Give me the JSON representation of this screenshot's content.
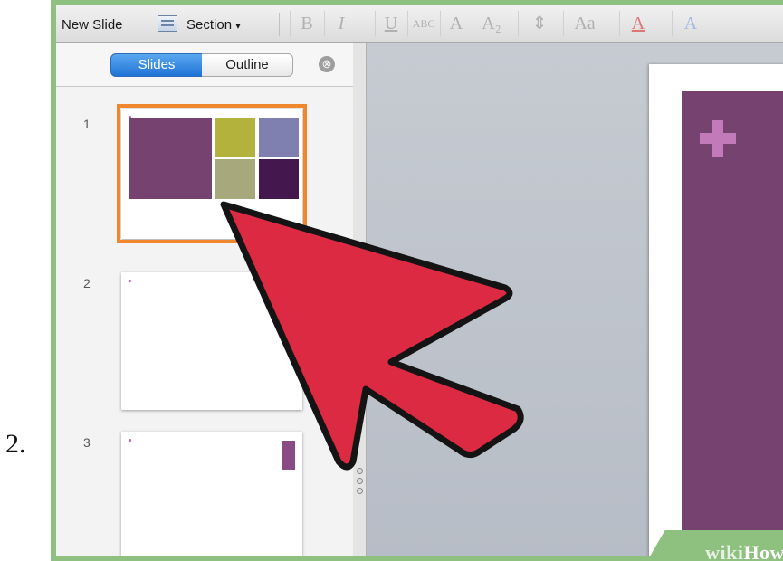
{
  "step": {
    "number": "2."
  },
  "toolbar": {
    "new_slide_label": "New Slide",
    "section_label": "Section",
    "section_arrow": "▾",
    "format_buttons": [
      "B",
      "I",
      "U",
      "ABC",
      "A",
      "A₂",
      "⇕",
      "Aa",
      "A",
      "A"
    ]
  },
  "sidebar": {
    "tabs": [
      {
        "label": "Slides",
        "selected": true
      },
      {
        "label": "Outline",
        "selected": false
      }
    ],
    "close_glyph": "⊗",
    "thumbnails": [
      {
        "number": "1",
        "selected": true
      },
      {
        "number": "2",
        "selected": false
      },
      {
        "number": "3",
        "selected": false
      }
    ]
  },
  "colors": {
    "selection_outline": "#f0872c",
    "slides_tab": "#1f73d6",
    "slide_purple": "#76426f",
    "arrow_fill": "#dc2a42",
    "wikihow_green": "#8ec07f"
  },
  "watermark": {
    "part1": "wiki",
    "part2": "How"
  }
}
